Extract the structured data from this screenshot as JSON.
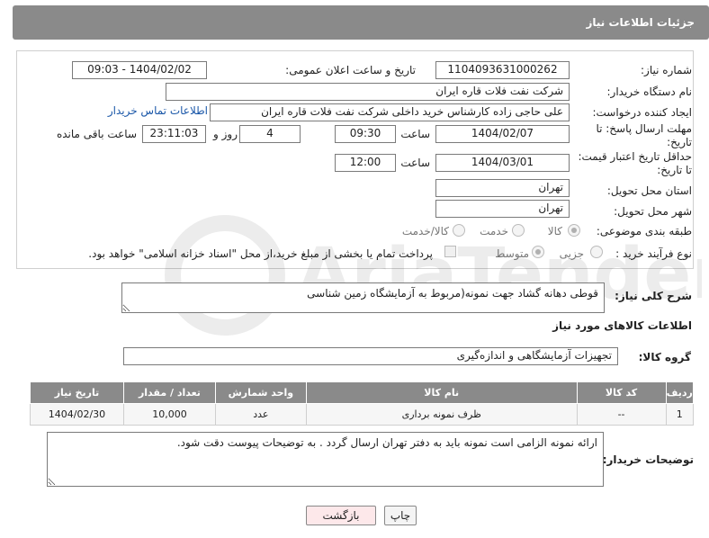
{
  "header": {
    "title": "جزئیات اطلاعات نیاز"
  },
  "form": {
    "need_number_label": "شماره نیاز:",
    "need_number": "1104093631000262",
    "announce_label": "تاریخ و ساعت اعلان عمومی:",
    "announce_value": "1404/02/02 - 09:03",
    "buyer_org_label": "نام دستگاه خریدار:",
    "buyer_org": "شرکت نفت فلات قاره ایران",
    "creator_label": "ایجاد کننده درخواست:",
    "creator": "علی حاجی زاده کارشناس خرید داخلی شرکت نفت فلات قاره ایران",
    "contact_link": "اطلاعات تماس خریدار",
    "deadline_label_1": "مهلت ارسال پاسخ: تا",
    "deadline_label_2": "تاریخ:",
    "deadline_date": "1404/02/07",
    "time_label": "ساعت",
    "deadline_time": "09:30",
    "days_value": "4",
    "days_label": "روز و",
    "remaining_time": "23:11:03",
    "remaining_label": "ساعت باقی مانده",
    "validity_label_1": "حداقل تاریخ اعتبار قیمت:",
    "validity_label_2": "تا تاریخ:",
    "validity_date": "1404/03/01",
    "validity_time": "12:00",
    "province_label": "استان محل تحویل:",
    "province": "تهران",
    "city_label": "شهر محل تحویل:",
    "city": "تهران",
    "category_label": "طبقه بندی موضوعی:",
    "category_options": [
      "کالا",
      "خدمت",
      "کالا/خدمت"
    ],
    "category_selected": "کالا",
    "process_label": "نوع فرآیند خرید :",
    "process_options": [
      "جزیی",
      "متوسط"
    ],
    "process_selected": "متوسط",
    "payment_note": "پرداخت تمام یا بخشی از مبلغ خرید،از محل \"اسناد خزانه اسلامی\" خواهد بود."
  },
  "description": {
    "label": "شرح کلی نیاز:",
    "value": "قوطی دهانه گشاد جهت نمونه(مربوط به آزمایشگاه زمین شناسی"
  },
  "goods": {
    "section_title": "اطلاعات کالاهای مورد نیاز",
    "group_label": "گروه کالا:",
    "group_value": "تجهیزات آزمایشگاهی و اندازه‌گیری",
    "columns": [
      "ردیف",
      "کد کالا",
      "نام کالا",
      "واحد شمارش",
      "تعداد / مقدار",
      "تاریخ نیاز"
    ],
    "rows": [
      [
        "1",
        "--",
        "ظرف نمونه برداری",
        "عدد",
        "10,000",
        "1404/02/30"
      ]
    ]
  },
  "notes": {
    "label": "توضیحات خریدار:",
    "value": "ارائه نمونه الزامی است نمونه باید به دفتر تهران ارسال گردد . به توضیحات پیوست دقت شود."
  },
  "buttons": {
    "print": "چاپ",
    "back": "بازگشت"
  },
  "colors": {
    "header_bg": "#8a8a8a",
    "link": "#1a57a8",
    "back_btn_bg": "#fde8ea"
  },
  "watermark_text": "AriaTender.net"
}
